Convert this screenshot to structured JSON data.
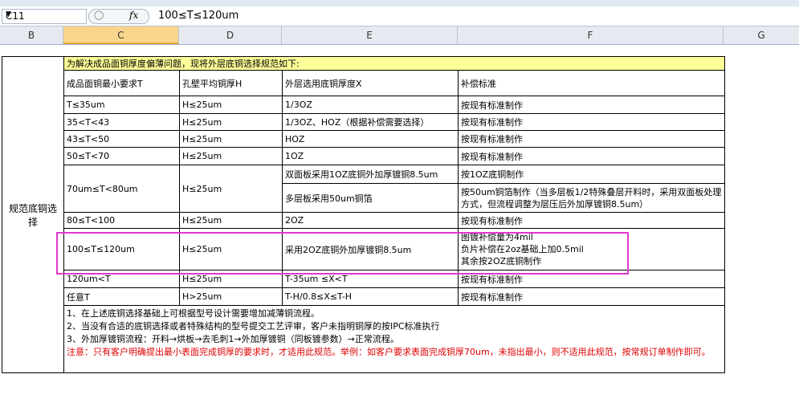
{
  "formula_bar": {
    "cell_ref": "C11",
    "cancel_icon": "circle-cancel-icon",
    "fx_label": "fx",
    "content": "100≤T≤120um"
  },
  "columns": [
    "B",
    "C",
    "D",
    "E",
    "F",
    "G"
  ],
  "selected_column": "C",
  "table": {
    "side_label": "规范底铜选择",
    "banner": "为解决成品面铜厚度偏薄问题，现将外层底铜选择规范如下:",
    "headers": [
      "成品面铜最小要求T",
      "孔壁平均铜厚H",
      "外层选用底铜厚度X",
      "补偿标准"
    ],
    "rows": [
      {
        "t": "T≤35um",
        "h": "H≤25um",
        "x": "1/3OZ",
        "std": "按现有标准制作"
      },
      {
        "t": "35<T<43",
        "h": "H≤25um",
        "x": "1/3OZ、HOZ（根据补偿需要选择）",
        "std": "按现有标准制作"
      },
      {
        "t": "43≤T<50",
        "h": "H≤25um",
        "x": "HOZ",
        "std": "按现有标准制作"
      },
      {
        "t": "50≤T<70",
        "h": "H≤25um",
        "x": "1OZ",
        "std": "按现有标准制作"
      },
      {
        "t": "70um≤T<80um",
        "h": "H≤25um",
        "x1": "双面板采用1OZ底铜外加厚镀铜8.5um",
        "std1": "按1OZ底铜制作",
        "x2": "多层板采用50um铜箔",
        "std2": "按50um铜箔制作（当多层板1/2特殊叠层开料时，采用双面板处理方式，但流程调整为层压后外加厚镀铜8.5um）"
      },
      {
        "t": "80≤T<100",
        "h": "H≤25um",
        "x": "2OZ",
        "std": "按现有标准制作"
      },
      {
        "t": "100≤T≤120um",
        "h": "H≤25um",
        "x": "采用2OZ底铜外加厚镀铜8.5um",
        "std_l1": "图镀补偿量为4mil",
        "std_l2": "负片补偿在2oz基础上加0.5mil",
        "std_l3": "其余按2OZ底铜制作"
      },
      {
        "t": "120um<T",
        "h": "H≤25um",
        "x": "T-35um ≤X<T",
        "std": "按现有标准制作"
      },
      {
        "t": "任意T",
        "h": "H>25um",
        "x": "T-H/0.8≤X≤T-H",
        "std": "按现有标准制作"
      }
    ],
    "notes": [
      "1、在上述底铜选择基础上可根据型号设计需要增加减薄铜流程。",
      "2、当没有合适的底铜选择或者特殊结构的型号提交工艺评审，客户未指明铜厚的按IPC标准执行",
      "3、外加厚镀铜流程：开料→烘板→去毛刺1→外加厚镀铜（同板镀参数）→正常流程。"
    ],
    "warning": "注意：只有客户明确提出最小表面完成铜厚的要求时，才适用此规范。举例：如客户要求表面完成铜厚70um，未指出最小，则不适用此规范，按常规订单制作即可。"
  },
  "colors": {
    "banner": "#ffff99",
    "highlight": "#e238c8",
    "warning": "#e00000"
  }
}
